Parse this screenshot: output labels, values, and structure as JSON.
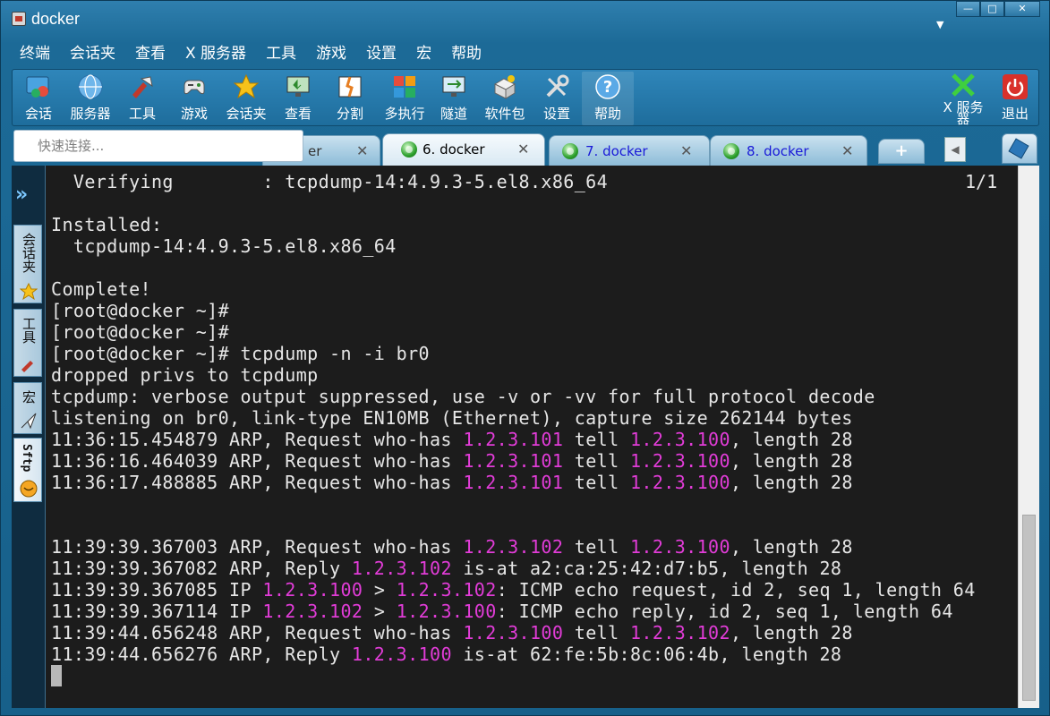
{
  "window": {
    "title": "docker"
  },
  "menu": [
    "终端",
    "会话夹",
    "查看",
    "X 服务器",
    "工具",
    "游戏",
    "设置",
    "宏",
    "帮助"
  ],
  "toolbar": {
    "items": [
      {
        "label": "会话",
        "icon": "sessions-icon"
      },
      {
        "label": "服务器",
        "icon": "globe-icon"
      },
      {
        "label": "工具",
        "icon": "tools-icon"
      },
      {
        "label": "游戏",
        "icon": "gamepad-icon"
      },
      {
        "label": "会话夹",
        "icon": "star-icon"
      },
      {
        "label": "查看",
        "icon": "monitor-icon"
      },
      {
        "label": "分割",
        "icon": "split-icon"
      },
      {
        "label": "多执行",
        "icon": "multi-exec-icon"
      },
      {
        "label": "隧道",
        "icon": "tunnel-icon"
      },
      {
        "label": "软件包",
        "icon": "packages-icon"
      },
      {
        "label": "设置",
        "icon": "wrench-icon"
      },
      {
        "label": "帮助",
        "icon": "help-icon"
      }
    ],
    "xserver_line1": "X 服务",
    "xserver_line2": "器",
    "exit_label": "退出"
  },
  "quick_connect": {
    "placeholder": "快速连接..."
  },
  "tabs": {
    "partial": "er",
    "active": "6. docker",
    "tab7": "7. docker",
    "tab8": "8. docker",
    "add": "+"
  },
  "sidebar": {
    "sessions": "会话夹",
    "tools": "工具",
    "macros": "宏",
    "sftp": "Sftp"
  },
  "terminal": {
    "counter": "1/1",
    "lines": [
      {
        "parts": [
          "  Verifying        : tcpdump-14:4.9.3-5.el8.x86_64"
        ]
      },
      {
        "parts": [
          ""
        ]
      },
      {
        "parts": [
          "Installed:"
        ]
      },
      {
        "parts": [
          "  tcpdump-14:4.9.3-5.el8.x86_64"
        ]
      },
      {
        "parts": [
          ""
        ]
      },
      {
        "parts": [
          "Complete!"
        ]
      },
      {
        "parts": [
          "[root@docker ~]#"
        ]
      },
      {
        "parts": [
          "[root@docker ~]#"
        ]
      },
      {
        "parts": [
          "[root@docker ~]# tcpdump -n -i br0"
        ]
      },
      {
        "parts": [
          "dropped privs to tcpdump"
        ]
      },
      {
        "parts": [
          "tcpdump: verbose output suppressed, use -v or -vv for full protocol decode"
        ]
      },
      {
        "parts": [
          "listening on br0, link-type EN10MB (Ethernet), capture size 262144 bytes"
        ]
      },
      {
        "parts": [
          "11:36:15.454879 ARP, Request who-has ",
          "1.2.3.101",
          " tell ",
          "1.2.3.100",
          ", length 28"
        ]
      },
      {
        "parts": [
          "11:36:16.464039 ARP, Request who-has ",
          "1.2.3.101",
          " tell ",
          "1.2.3.100",
          ", length 28"
        ]
      },
      {
        "parts": [
          "11:36:17.488885 ARP, Request who-has ",
          "1.2.3.101",
          " tell ",
          "1.2.3.100",
          ", length 28"
        ]
      },
      {
        "parts": [
          ""
        ]
      },
      {
        "parts": [
          ""
        ]
      },
      {
        "parts": [
          "11:39:39.367003 ARP, Request who-has ",
          "1.2.3.102",
          " tell ",
          "1.2.3.100",
          ", length 28"
        ]
      },
      {
        "parts": [
          "11:39:39.367082 ARP, Reply ",
          "1.2.3.102",
          " is-at a2:ca:25:42:d7:b5, length 28"
        ]
      },
      {
        "parts": [
          "11:39:39.367085 IP ",
          "1.2.3.100",
          " > ",
          "1.2.3.102",
          ": ICMP echo request, id 2, seq 1, length 64"
        ]
      },
      {
        "parts": [
          "11:39:39.367114 IP ",
          "1.2.3.102",
          " > ",
          "1.2.3.100",
          ": ICMP echo reply, id 2, seq 1, length 64"
        ]
      },
      {
        "parts": [
          "11:39:44.656248 ARP, Request who-has ",
          "1.2.3.100",
          " tell ",
          "1.2.3.102",
          ", length 28"
        ]
      },
      {
        "parts": [
          "11:39:44.656276 ARP, Reply ",
          "1.2.3.100",
          " is-at 62:fe:5b:8c:06:4b, length 28"
        ]
      }
    ]
  },
  "colors": {
    "ip_highlight": "#e23cd8",
    "terminal_bg": "#1c1c1c",
    "terminal_fg": "#e6e6e6"
  }
}
